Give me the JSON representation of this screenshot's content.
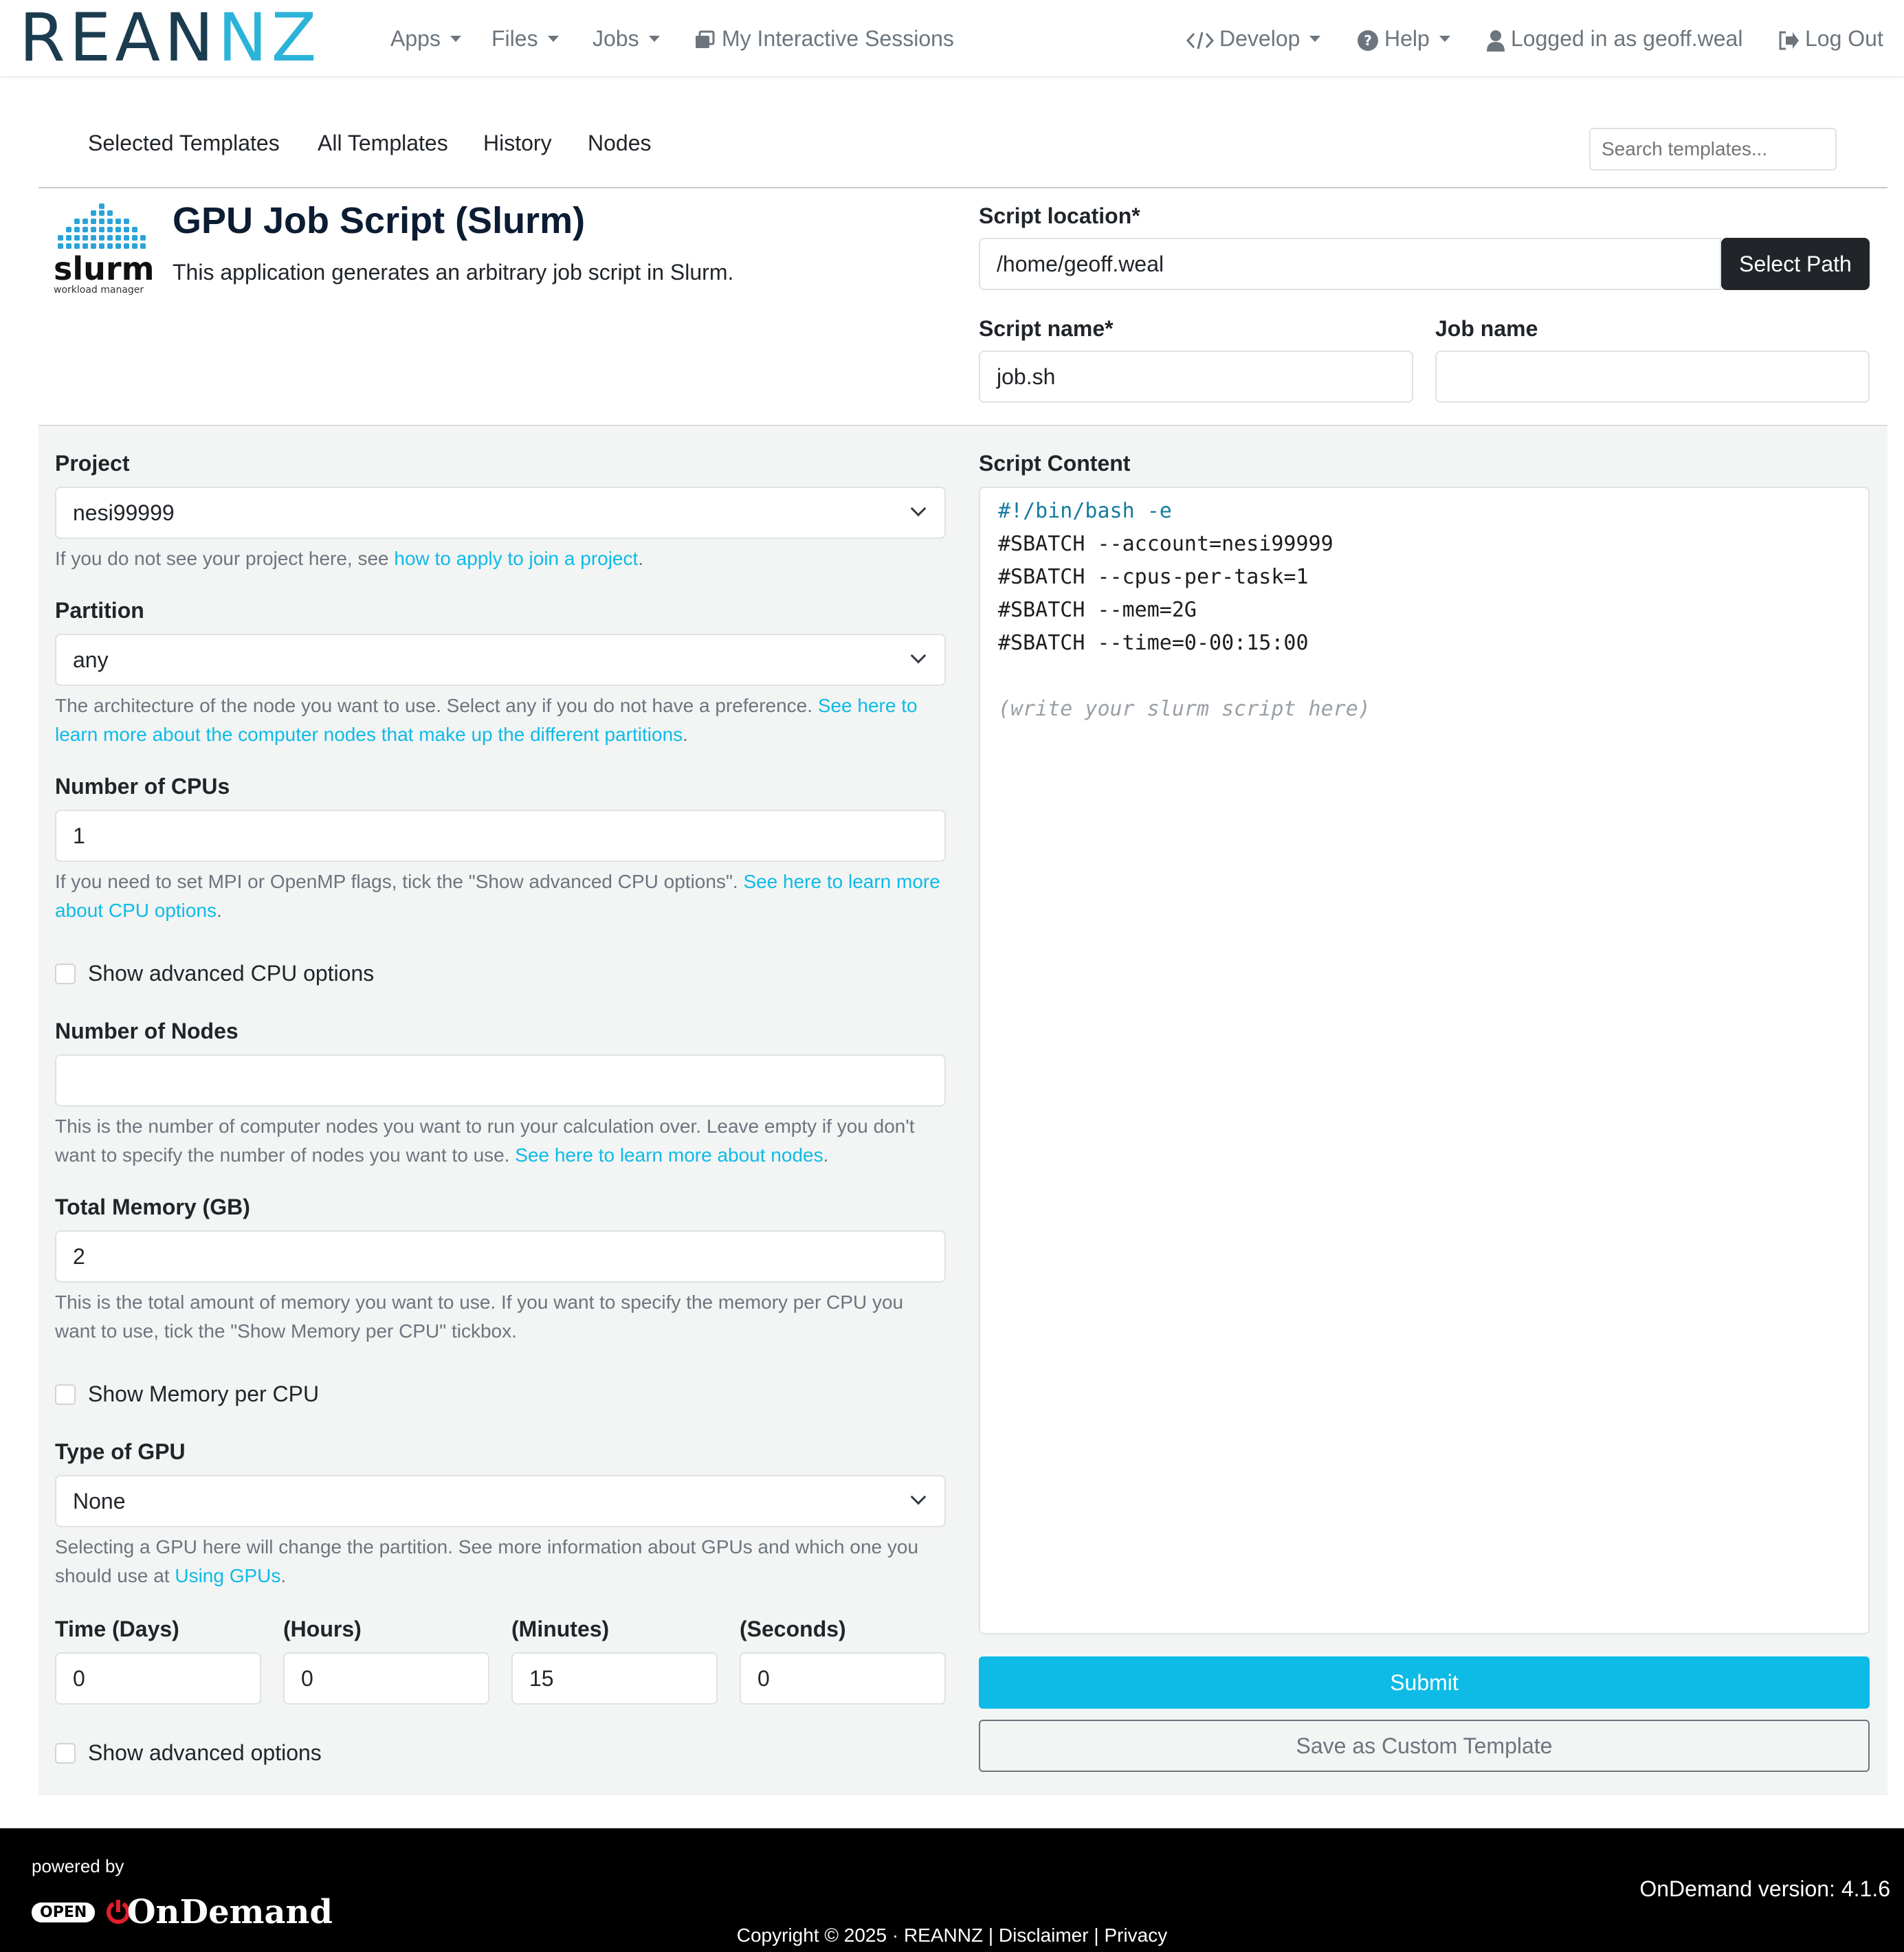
{
  "brand": {
    "logo_left": "REAN",
    "logo_right": "NZ"
  },
  "navbar": {
    "apps": "Apps",
    "files": "Files",
    "jobs": "Jobs",
    "sessions": "My Interactive Sessions",
    "develop": "Develop",
    "help": "Help",
    "user": "Logged in as geoff.weal",
    "logout": "Log Out"
  },
  "subnav": {
    "selected_templates": "Selected Templates",
    "all_templates": "All Templates",
    "history": "History",
    "nodes": "Nodes",
    "search_placeholder": "Search templates..."
  },
  "app": {
    "logo_text": "slurm",
    "logo_subtext": "workload manager",
    "title": "GPU Job Script (Slurm)",
    "description": "This application generates an arbitrary job script in Slurm."
  },
  "script_location": {
    "label": "Script location*",
    "value": "/home/geoff.weal",
    "button": "Select Path"
  },
  "script_name": {
    "label": "Script name*",
    "value": "job.sh"
  },
  "job_name": {
    "label": "Job name",
    "value": ""
  },
  "form": {
    "project": {
      "label": "Project",
      "value": "nesi99999",
      "help_text": "If you do not see your project here, see ",
      "help_link": "how to apply to join a project",
      "help_end": "."
    },
    "partition": {
      "label": "Partition",
      "value": "any",
      "help_text": "The architecture of the node you want to use. Select any if you do not have a preference. ",
      "help_link": "See here to learn more about the computer nodes that make up the different partitions",
      "help_end": "."
    },
    "cpus": {
      "label": "Number of CPUs",
      "value": "1",
      "help_text": "If you need to set MPI or OpenMP flags, tick the \"Show advanced CPU options\". ",
      "help_link": "See here to learn more about CPU options",
      "help_end": "."
    },
    "show_advanced_cpu": "Show advanced CPU options",
    "nodes": {
      "label": "Number of Nodes",
      "value": "",
      "help_text": "This is the number of computer nodes you want to run your calculation over. Leave empty if you don't want to specify the number of nodes you want to use. ",
      "help_link": "See here to learn more about nodes",
      "help_end": "."
    },
    "memory": {
      "label": "Total Memory (GB)",
      "value": "2",
      "help_text": "This is the total amount of memory you want to use. If you want to specify the memory per CPU you want to use, tick the \"Show Memory per CPU\" tickbox."
    },
    "show_mem_per_cpu": "Show Memory per CPU",
    "gpu": {
      "label": "Type of GPU",
      "value": "None",
      "help_text": "Selecting a GPU here will change the partition. See more information about GPUs and which one you should use at ",
      "help_link": "Using GPUs",
      "help_end": "."
    },
    "time": {
      "days_label": "Time (Days)",
      "days": "0",
      "hours_label": "(Hours)",
      "hours": "0",
      "minutes_label": "(Minutes)",
      "minutes": "15",
      "seconds_label": "(Seconds)",
      "seconds": "0"
    },
    "show_advanced": "Show advanced options"
  },
  "script": {
    "label": "Script Content",
    "lines": [
      "#!/bin/bash -e",
      "#SBATCH --account=nesi99999",
      "#SBATCH --cpus-per-task=1",
      "#SBATCH --mem=2G",
      "#SBATCH --time=0-00:15:00",
      "",
      "(write your slurm script here)"
    ]
  },
  "actions": {
    "submit": "Submit",
    "save_template": "Save as Custom Template"
  },
  "footer": {
    "powered_by": "powered by",
    "open_badge": "OPEN",
    "ondemand": "OnDemand",
    "version": "OnDemand version: 4.1.6",
    "copyright": "Copyright © 2025 · REANNZ",
    "disclaimer": "Disclaimer",
    "privacy": "Privacy"
  }
}
